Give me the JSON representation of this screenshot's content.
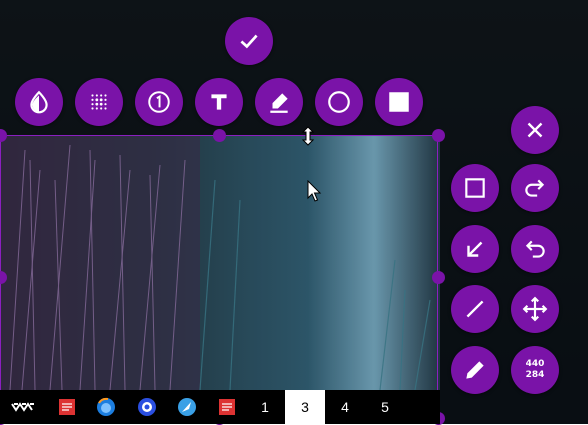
{
  "toolbar_top": {
    "confirm": {
      "icon": "check-icon"
    },
    "tools": [
      {
        "name": "blur",
        "icon": "drop-icon"
      },
      {
        "name": "pixelate",
        "icon": "dots-grid-icon"
      },
      {
        "name": "counter",
        "icon": "number-circle-icon"
      },
      {
        "name": "text",
        "icon": "text-t-icon"
      },
      {
        "name": "marker",
        "icon": "marker-icon"
      },
      {
        "name": "circle",
        "icon": "circle-icon"
      },
      {
        "name": "filled-rectangle",
        "icon": "filled-square-icon"
      }
    ]
  },
  "toolbar_side": {
    "close": {
      "icon": "close-icon"
    },
    "rectangle": {
      "icon": "square-outline-icon"
    },
    "redo": {
      "icon": "redo-icon"
    },
    "arrow": {
      "icon": "arrow-down-left-icon"
    },
    "undo": {
      "icon": "undo-icon"
    },
    "line": {
      "icon": "line-icon"
    },
    "move": {
      "icon": "move-icon"
    },
    "pencil": {
      "icon": "pencil-icon"
    },
    "selection_size": {
      "width": "440",
      "height": "284"
    }
  },
  "taskbar": {
    "workspaces": [
      "1",
      "3",
      "4",
      "5"
    ],
    "active_workspace": "3"
  },
  "colors": {
    "accent": "#7a13a8"
  }
}
